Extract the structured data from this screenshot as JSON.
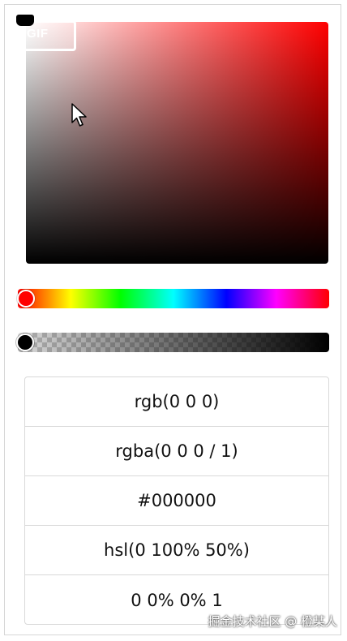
{
  "watermark": {
    "badge_text": "GIF",
    "footer": "掘金技术社区 @ 橙某人"
  },
  "picker": {
    "hue_color": "#ff0000",
    "selected_color": "#000000",
    "hue_level": 0,
    "alpha_level": 0
  },
  "values": [
    "rgb(0 0 0)",
    "rgba(0 0 0 / 1)",
    "#000000",
    "hsl(0 100% 50%)",
    "0 0% 0% 1"
  ]
}
